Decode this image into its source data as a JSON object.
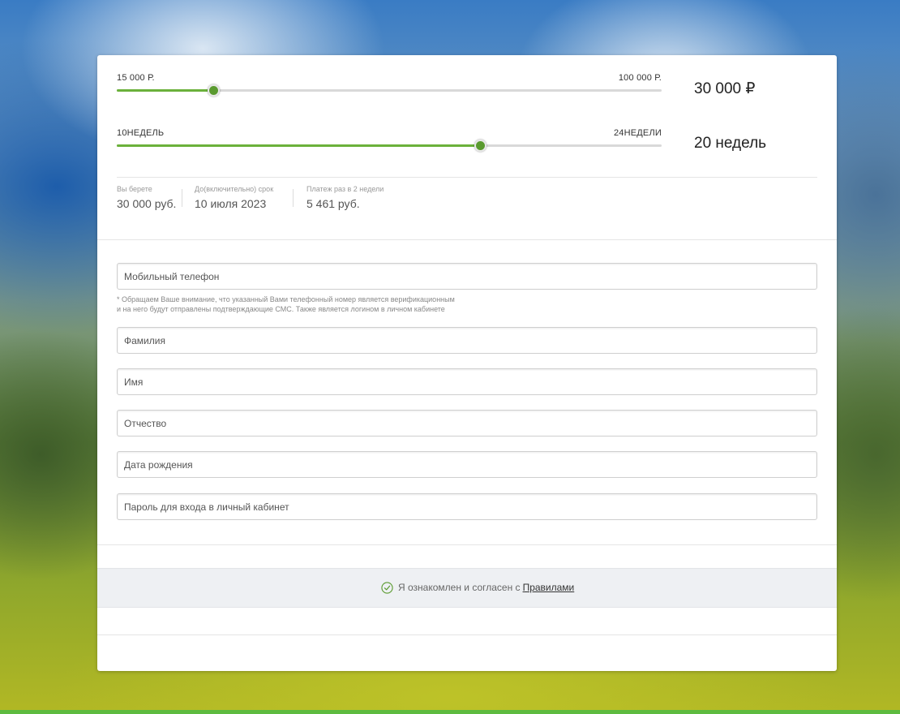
{
  "amount_slider": {
    "min_label": "15 000 Р.",
    "max_label": "100 000 Р.",
    "value_label": "30 000  ₽",
    "fill_fraction": 0.176
  },
  "term_slider": {
    "min_label": "10НЕДЕЛЬ",
    "max_label": "24НЕДЕЛИ",
    "value_label": "20 недель",
    "fill_fraction": 0.665
  },
  "summary": {
    "take_label": "Вы берете",
    "take_value": "30 000 руб.",
    "due_label": "До(включительно) срок",
    "due_value": "10 июля 2023",
    "payment_label": "Платеж раз в 2 недели",
    "payment_value": "5 461 руб."
  },
  "form": {
    "phone_placeholder": "Мобильный телефон",
    "phone_note_line1": "* Обращаем Ваше внимание, что указанный Вами телефонный номер является верификационным",
    "phone_note_line2": "и на него будут отправлены подтверждающие СМС. Также является логином в личном кабинете",
    "surname_placeholder": "Фамилия",
    "name_placeholder": "Имя",
    "patronymic_placeholder": "Отчество",
    "birthdate_placeholder": "Дата рождения",
    "password_placeholder": "Пароль для входа в личный кабинет"
  },
  "agreement": {
    "text": "Я ознакомлен и согласен с",
    "link_text": "Правилами",
    "checked": true
  },
  "colors": {
    "accent_green": "#6bb13b",
    "thumb_green": "#5a9a2f",
    "agree_bar_bg": "#eef0f3"
  },
  "icons": {
    "agree_check": "check-circle-icon"
  }
}
